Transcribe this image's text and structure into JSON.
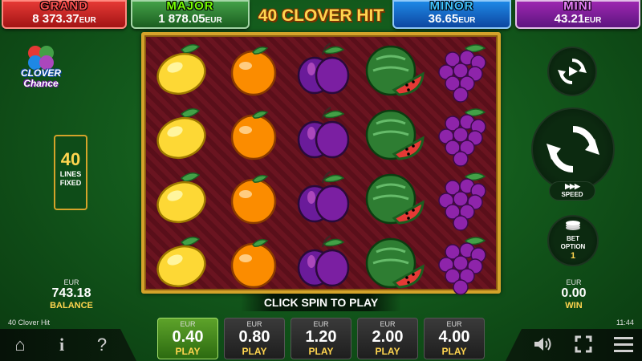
{
  "jackpots": [
    {
      "name": "GRAND",
      "value": "8 373.37",
      "currency": "EUR"
    },
    {
      "name": "MAJOR",
      "value": "1 878.05",
      "currency": "EUR"
    },
    {
      "name": "MINOR",
      "value": "36.65",
      "currency": "EUR"
    },
    {
      "name": "MINI",
      "value": "43.21",
      "currency": "EUR"
    }
  ],
  "game_title": "40 CLOVER HIT",
  "logo": {
    "line1": "CLOVER",
    "line2": "Chance"
  },
  "lines": {
    "count": "40",
    "label1": "LINES",
    "label2": "FIXED"
  },
  "balance": {
    "currency": "EUR",
    "value": "743.18",
    "label": "BALANCE"
  },
  "win": {
    "currency": "EUR",
    "value": "0.00",
    "label": "WIN"
  },
  "reels": [
    [
      "lemon",
      "lemon",
      "lemon",
      "lemon"
    ],
    [
      "orange",
      "orange",
      "orange",
      "orange"
    ],
    [
      "plum",
      "plum",
      "plum",
      "plum"
    ],
    [
      "watermelon",
      "watermelon",
      "watermelon",
      "watermelon"
    ],
    [
      "grapes",
      "grapes",
      "grapes",
      "grapes"
    ]
  ],
  "click_spin": "CLICK SPIN TO PLAY",
  "controls": {
    "speed_label": "SPEED",
    "bet_option_label1": "BET",
    "bet_option_label2": "OPTION",
    "bet_option_value": "1"
  },
  "bets": [
    {
      "currency": "EUR",
      "value": "0.40",
      "label": "PLAY",
      "active": true
    },
    {
      "currency": "EUR",
      "value": "0.80",
      "label": "PLAY",
      "active": false
    },
    {
      "currency": "EUR",
      "value": "1.20",
      "label": "PLAY",
      "active": false
    },
    {
      "currency": "EUR",
      "value": "2.00",
      "label": "PLAY",
      "active": false
    },
    {
      "currency": "EUR",
      "value": "4.00",
      "label": "PLAY",
      "active": false
    }
  ],
  "footer": {
    "game_name": "40 Clover Hit",
    "time": "11:44"
  },
  "icons": {
    "home": "home-icon",
    "info": "info-icon",
    "help": "help-icon",
    "sound": "sound-icon",
    "fullscreen": "fullscreen-icon",
    "menu": "menu-icon"
  },
  "colors": {
    "frame_gold": "#d4a32a",
    "background_green": "#135a1c",
    "accent_yellow": "#ffd54f"
  }
}
